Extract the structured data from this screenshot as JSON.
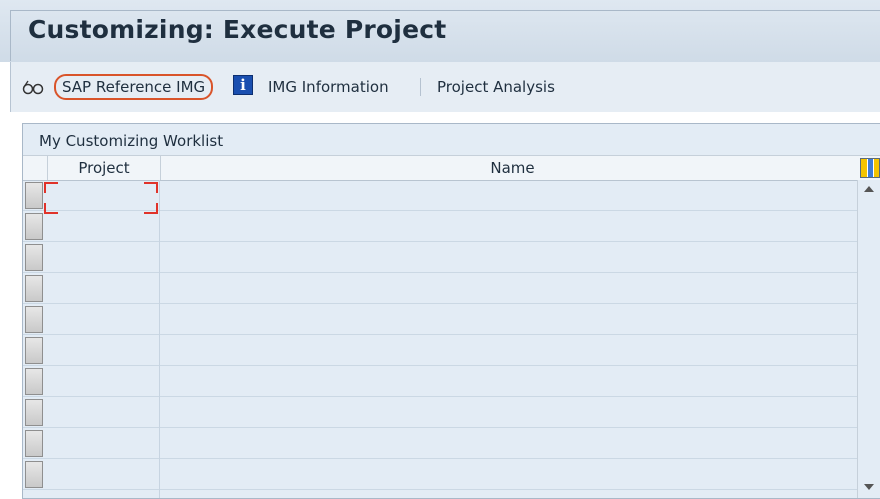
{
  "header": {
    "title": "Customizing: Execute Project"
  },
  "toolbar": {
    "sap_reference_img": "SAP Reference IMG",
    "img_information": "IMG Information",
    "project_analysis": "Project Analysis",
    "icons": [
      "glasses-icon",
      "info-icon"
    ]
  },
  "worklist": {
    "title": "My Customizing Worklist",
    "columns": [
      "Project",
      "Name"
    ],
    "rows": [
      {
        "project": "",
        "name": ""
      },
      {
        "project": "",
        "name": ""
      },
      {
        "project": "",
        "name": ""
      },
      {
        "project": "",
        "name": ""
      },
      {
        "project": "",
        "name": ""
      },
      {
        "project": "",
        "name": ""
      },
      {
        "project": "",
        "name": ""
      },
      {
        "project": "",
        "name": ""
      },
      {
        "project": "",
        "name": ""
      },
      {
        "project": "",
        "name": ""
      }
    ]
  },
  "colors": {
    "highlight": "#d9542a",
    "focus_corners": "#e0332a",
    "grid_bg": "#e3ecf5"
  }
}
